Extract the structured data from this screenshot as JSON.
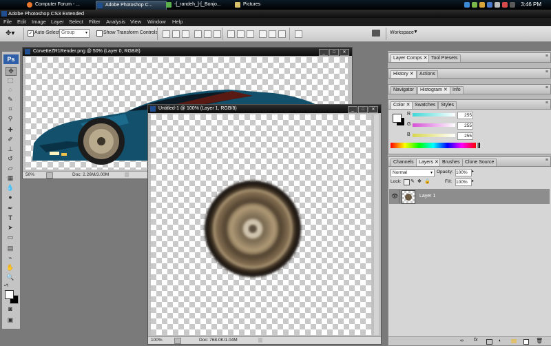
{
  "taskbar": {
    "tasks": [
      {
        "label": "Computer Forum - ..."
      },
      {
        "label": "Adobe Photoshop C..."
      },
      {
        "label": "-[_randeh_]-[_Bonjo..."
      },
      {
        "label": "Pictures"
      }
    ],
    "clock": "3:46 PM"
  },
  "app": {
    "title": "Adobe Photoshop CS3 Extended",
    "logo": "Ps"
  },
  "menu": [
    "File",
    "Edit",
    "Image",
    "Layer",
    "Select",
    "Filter",
    "Analysis",
    "View",
    "Window",
    "Help"
  ],
  "options": {
    "auto_select_label": "Auto-Select:",
    "auto_select_value": "Group",
    "show_transform_label": "Show Transform Controls",
    "workspace_label": "Workspace"
  },
  "doc1": {
    "title": "CorvetteZR1Render.png @ 50% (Layer 0, RGB/8)",
    "zoom": "50%",
    "doc": "Doc: 2.26M/3.00M"
  },
  "doc2": {
    "title": "Untitled-1 @ 100% (Layer 1, RGB/8)",
    "zoom": "100%",
    "doc": "Doc: 768.0K/1.04M"
  },
  "panels": {
    "row1": [
      "Layer Comps",
      "Tool Presets"
    ],
    "row2": [
      "History",
      "Actions"
    ],
    "row3": [
      "Navigator",
      "Histogram",
      "Info"
    ],
    "row4": [
      "Color",
      "Swatches",
      "Styles"
    ],
    "color": {
      "channels": [
        {
          "label": "R",
          "value": "255",
          "color": "#3fd8d8"
        },
        {
          "label": "G",
          "value": "255",
          "color": "#d64fd6"
        },
        {
          "label": "B",
          "value": "255",
          "color": "#d6d64f"
        }
      ]
    },
    "row5": [
      "Channels",
      "Layers",
      "Brushes",
      "Clone Source"
    ],
    "layers": {
      "blend_mode": "Normal",
      "opacity_label": "Opacity:",
      "opacity": "100%",
      "lock_label": "Lock:",
      "fill_label": "Fill:",
      "fill": "100%",
      "layer_name": "Layer 1"
    }
  }
}
